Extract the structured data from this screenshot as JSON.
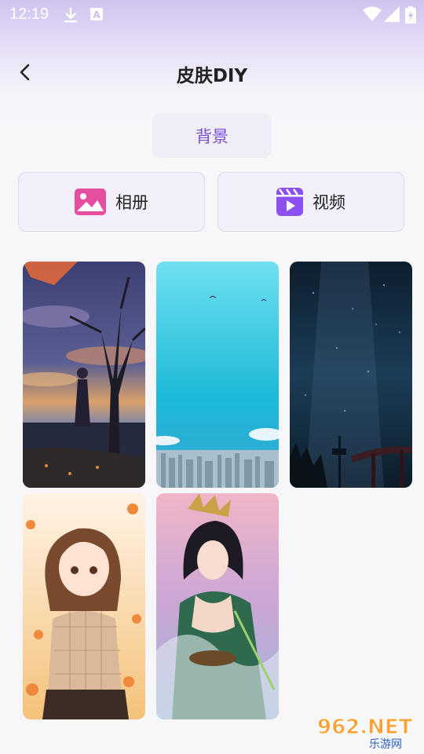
{
  "status_bar": {
    "time": "12:19",
    "icons": [
      "download-icon",
      "text-a-icon",
      "wifi-icon",
      "signal-icon",
      "battery-charging-icon"
    ]
  },
  "header": {
    "title": "皮肤DIY",
    "back_icon": "chevron-left-icon"
  },
  "background_tab": {
    "label": "背景"
  },
  "sources": [
    {
      "label": "相册",
      "icon": "image-gallery-icon",
      "color": "#e64fa0"
    },
    {
      "label": "视频",
      "icon": "video-play-icon",
      "color": "#8c4ff0"
    }
  ],
  "wallpapers": [
    {
      "name": "autumn-tree-girl"
    },
    {
      "name": "blue-sky-city"
    },
    {
      "name": "night-starry-sky-torii"
    },
    {
      "name": "anime-girl-maple"
    },
    {
      "name": "fantasy-warrior-woman"
    }
  ],
  "watermark": {
    "line1": "962.NET",
    "line2": "乐游网"
  },
  "colors": {
    "accent": "#7a4fd6",
    "album_icon": "#e64fa0",
    "video_icon": "#8c4ff0"
  }
}
